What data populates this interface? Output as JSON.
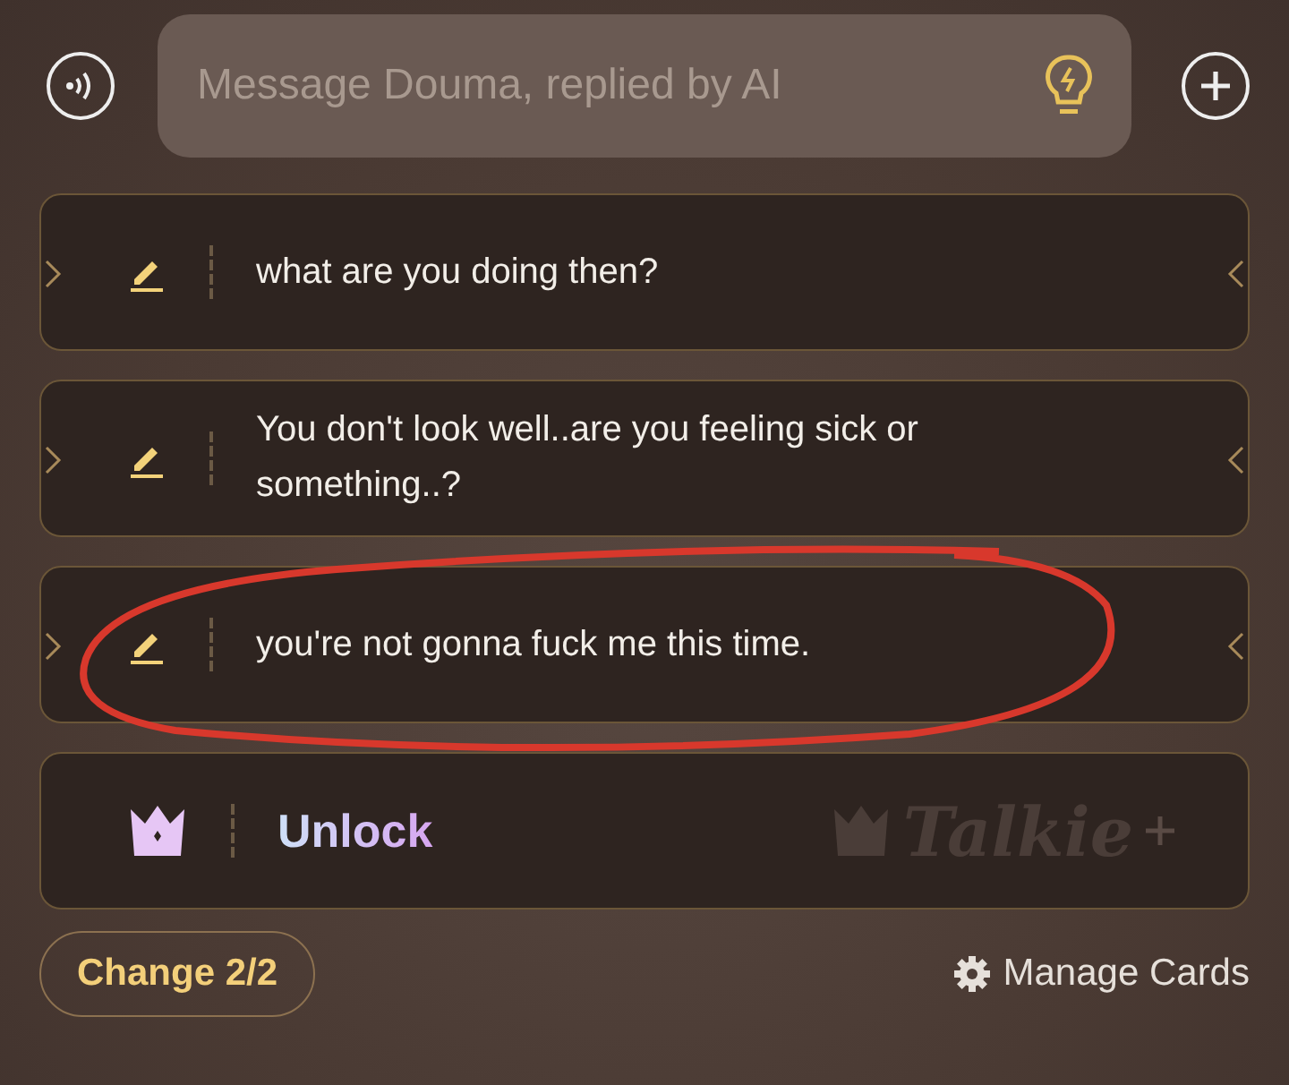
{
  "composer": {
    "placeholder": "Message Douma, replied by AI"
  },
  "suggestions": [
    {
      "kind": "reply",
      "text": "what are you doing then?",
      "circled": false
    },
    {
      "kind": "reply",
      "text": "You don't look well..are you feeling sick or something..?",
      "circled": false
    },
    {
      "kind": "reply",
      "text": "you're not gonna fuck me this time.",
      "circled": true
    },
    {
      "kind": "unlock",
      "text": "Unlock",
      "brand": "Talkie"
    }
  ],
  "change_button": "Change 2/2",
  "manage_link": "Manage Cards"
}
